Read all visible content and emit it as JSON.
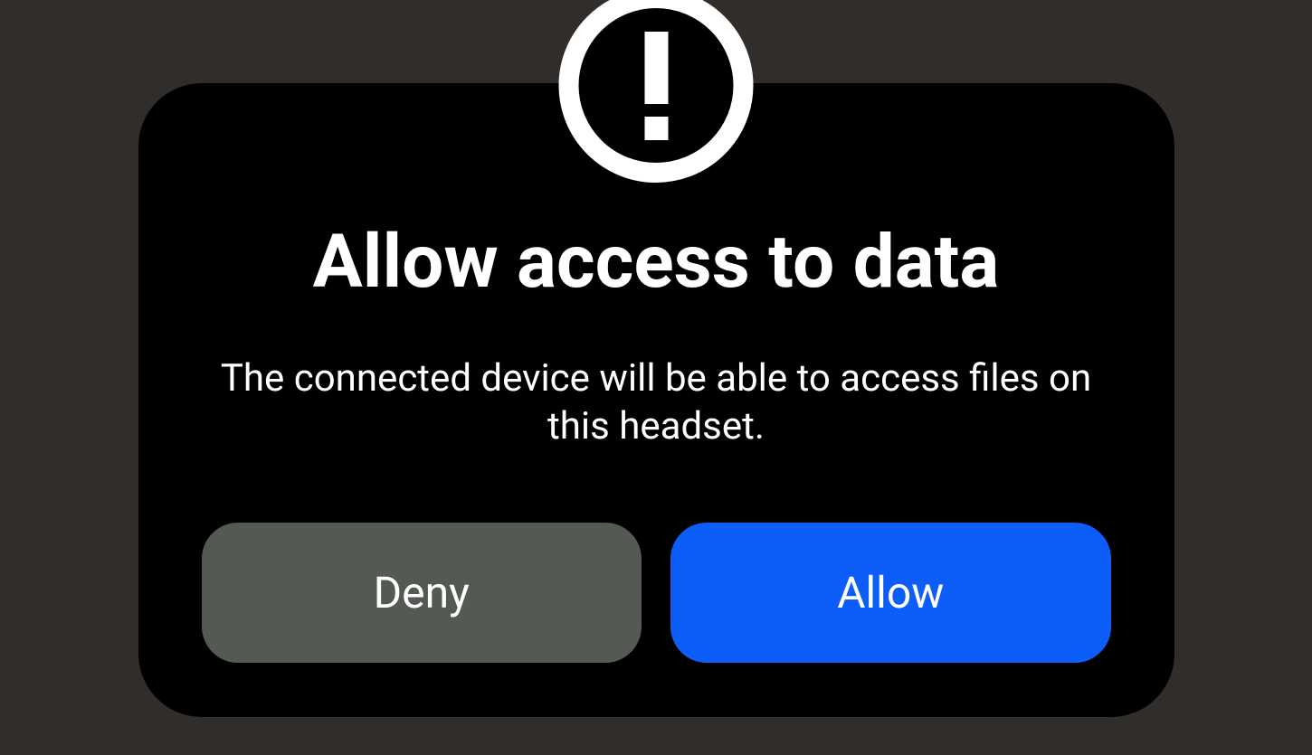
{
  "dialog": {
    "title": "Allow access to data",
    "body": "The connected device will be able to access files on this headset.",
    "buttons": {
      "deny_label": "Deny",
      "allow_label": "Allow"
    },
    "icon": "exclamation-circle",
    "colors": {
      "backdrop": "#312d2a",
      "dialog_bg": "#000000",
      "text": "#ffffff",
      "deny_bg": "#555953",
      "allow_bg": "#0d5ef8"
    }
  }
}
